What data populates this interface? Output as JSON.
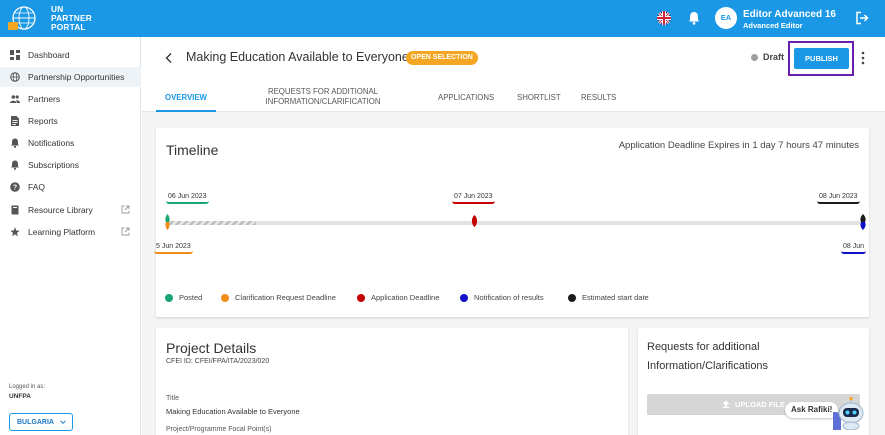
{
  "header": {
    "brand_line1": "UN",
    "brand_line2": "PARTNER",
    "brand_line3": "PORTAL",
    "user_initials": "EA",
    "user_name": "Editor Advanced 16",
    "user_role": "Advanced Editor",
    "icons": [
      "un-logo-icon",
      "uk-flag-icon",
      "bell-icon",
      "logout-icon"
    ],
    "color": "#1a98e6"
  },
  "sidebar": {
    "items": [
      {
        "label": "Dashboard",
        "icon": "dashboard-icon"
      },
      {
        "label": "Partnership Opportunities",
        "icon": "globe-icon",
        "active": true
      },
      {
        "label": "Partners",
        "icon": "people-icon"
      },
      {
        "label": "Reports",
        "icon": "report-icon"
      },
      {
        "label": "Notifications",
        "icon": "bell-icon"
      },
      {
        "label": "Subscriptions",
        "icon": "subscriptions-icon"
      },
      {
        "label": "FAQ",
        "icon": "help-icon"
      },
      {
        "label": "Resource Library",
        "icon": "book-icon",
        "external": true
      },
      {
        "label": "Learning Platform",
        "icon": "star-icon",
        "external": true
      }
    ],
    "logged_in_label": "Logged in as:",
    "logged_in_org": "UNFPA",
    "country": "BULGARIA"
  },
  "page": {
    "title": "Making Education Available to Everyone",
    "status_badge": "OPEN SELECTION",
    "draft_label": "Draft",
    "publish_label": "PUBLISH"
  },
  "tabs": [
    {
      "label": "OVERVIEW",
      "active": true
    },
    {
      "label_line1": "REQUESTS FOR ADDITIONAL",
      "label_line2": "INFORMATION/CLARIFICATION"
    },
    {
      "label": "APPLICATIONS"
    },
    {
      "label": "SHORTLIST"
    },
    {
      "label": "RESULTS"
    }
  ],
  "timeline": {
    "title": "Timeline",
    "deadline_text": "Application Deadline Expires in 1 day 7 hours 47 minutes",
    "dates": {
      "posted_top": "06 Jun 2023",
      "deadline_top": "07 Jun 2023",
      "start_top": "08 Jun 2023",
      "clarification_bottom": "5 Jun 2023",
      "results_bottom": "08 Jun"
    },
    "legend": [
      {
        "label": "Posted",
        "color": "#1aa672"
      },
      {
        "label": "Clarification Request Deadline",
        "color": "#f28c1b"
      },
      {
        "label": "Application Deadline",
        "color": "#c40000"
      },
      {
        "label": "Notification of results",
        "color": "#1010c8"
      },
      {
        "label": "Estimated start date",
        "color": "#1c1c1c"
      }
    ]
  },
  "project_details": {
    "title": "Project Details",
    "cfei": "CFEI ID: CFEI/FPA/ITA/2023/020",
    "title_label": "Title",
    "title_value": "Making Education Available to Everyone",
    "focal_label": "Project/Programme Focal Point(s)"
  },
  "requests_card": {
    "title": "Requests for additional Information/Clarifications",
    "upload_label": "UPLOAD FILE"
  },
  "assistant": {
    "label": "Ask Rafiki!"
  }
}
